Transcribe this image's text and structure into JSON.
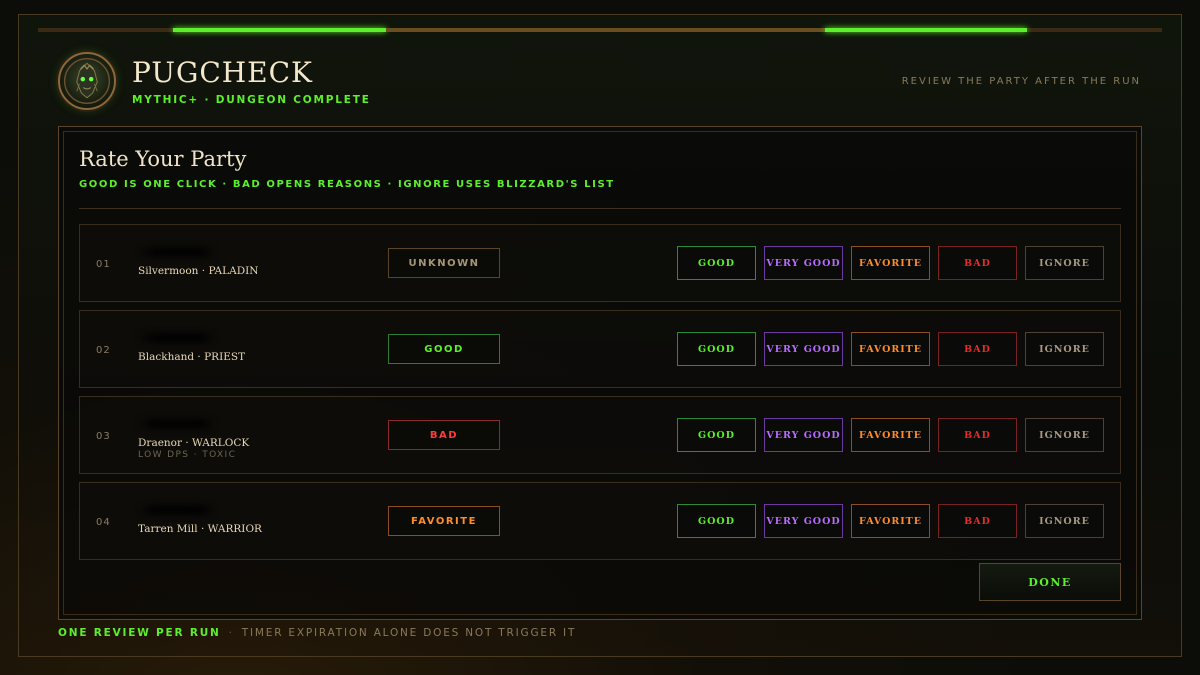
{
  "header": {
    "title": "PUGCHECK",
    "subtitle": "MYTHIC+ · DUNGEON COMPLETE",
    "right_text": "REVIEW THE PARTY AFTER THE RUN"
  },
  "panel": {
    "title": "Rate Your Party",
    "subtitle": "GOOD IS ONE CLICK · BAD OPENS REASONS · IGNORE USES BLIZZARD'S LIST"
  },
  "rating_buttons": {
    "good": "GOOD",
    "very_good": "VERY GOOD",
    "favorite": "FAVORITE",
    "bad": "BAD",
    "ignore": "IGNORE"
  },
  "party": [
    {
      "index": "01",
      "realm_class": "Silvermoon · PALADIN",
      "note": "",
      "status": "UNKNOWN",
      "status_kind": "unknown"
    },
    {
      "index": "02",
      "realm_class": "Blackhand · PRIEST",
      "note": "",
      "status": "GOOD",
      "status_kind": "good"
    },
    {
      "index": "03",
      "realm_class": "Draenor · WARLOCK",
      "note": "LOW DPS · TOXIC",
      "status": "BAD",
      "status_kind": "bad"
    },
    {
      "index": "04",
      "realm_class": "Tarren Mill · WARRIOR",
      "note": "",
      "status": "FAVORITE",
      "status_kind": "favorite"
    }
  ],
  "done_label": "DONE",
  "footer": {
    "strong": "ONE REVIEW PER RUN",
    "separator": "·",
    "rest": "TIMER EXPIRATION ALONE DOES NOT TRIGGER IT"
  },
  "colors": {
    "accent_green": "#5cf02c",
    "very_good_purple": "#b86cff",
    "favorite_orange": "#ff8c2a",
    "bad_red": "#e82a2a",
    "gold_border": "#5a452a"
  }
}
